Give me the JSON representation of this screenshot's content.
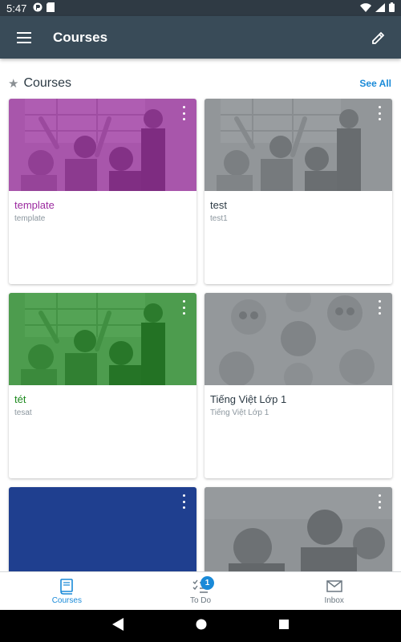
{
  "status_bar": {
    "time": "5:47"
  },
  "app_bar": {
    "title": "Courses"
  },
  "section": {
    "title": "Courses",
    "see_all": "See All"
  },
  "courses": [
    {
      "name": "template",
      "code": "template",
      "color": "#9b2a9f",
      "image": "classroom"
    },
    {
      "name": "test",
      "code": "test1",
      "color": "#7d8287",
      "image": "classroom"
    },
    {
      "name": "tét",
      "code": "tesat",
      "color": "#1d8a1e",
      "image": "classroom"
    },
    {
      "name": "Tiếng Việt Lớp 1",
      "code": "Tiếng Việt Lớp 1",
      "color": "#7d8287",
      "image": "kids-circle"
    },
    {
      "name": "",
      "code": "",
      "color": "#1f3f8f",
      "image": "none"
    },
    {
      "name": "",
      "code": "",
      "color": "#7d8287",
      "image": "students"
    }
  ],
  "bottom_nav": {
    "tabs": [
      {
        "label": "Courses",
        "icon": "book-icon",
        "active": true
      },
      {
        "label": "To Do",
        "icon": "checklist-icon",
        "badge": "1"
      },
      {
        "label": "Inbox",
        "icon": "envelope-icon"
      }
    ]
  },
  "colors": {
    "app_bar": "#394b58",
    "accent": "#1a8ad8"
  }
}
